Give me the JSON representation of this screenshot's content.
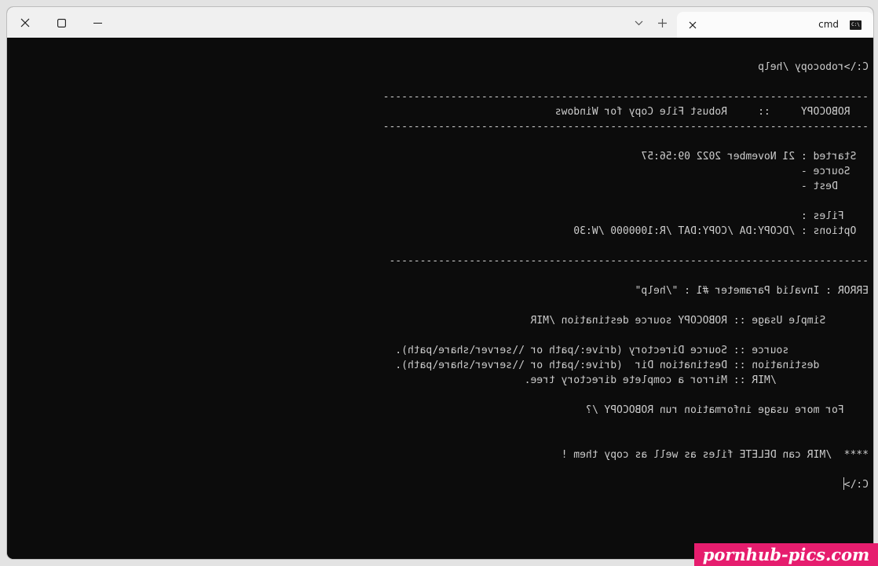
{
  "window": {
    "tab_title": "cmd",
    "tab_icon_glyph": "C:\\",
    "controls": [
      "close-icon",
      "maximize-icon",
      "minimize-icon",
      "chevron-down-icon",
      "plus-icon"
    ]
  },
  "console": {
    "lines": [
      "C:\\>robocopy /help",
      "",
      "-------------------------------------------------------------------------------",
      "   ROBOCOPY     ::     Robust File Copy for Windows",
      "-------------------------------------------------------------------------------",
      "",
      "  Started : 21 November 2022 09:56:57",
      "   Source -",
      "     Dest -",
      "",
      "    Files :",
      "  Options : /DCOPY:DA /COPY:DAT /R:1000000 /W:30",
      "",
      "------------------------------------------------------------------------------",
      "",
      "ERROR : Invalid Parameter #1 : \"/help\"",
      "",
      "       Simple Usage :: ROBOCOPY source destination /MIR",
      "",
      "             source :: Source Directory (drive:\\path or \\\\server\\share\\path).",
      "        destination :: Destination Dir  (drive:\\path or \\\\server\\share\\path).",
      "               /MIR :: Mirror a complete directory tree.",
      "",
      "    For more usage information run ROBOCOPY /?",
      "",
      "",
      "****  /MIR can DELETE files as well as copy them !",
      "",
      "C:\\>"
    ]
  },
  "watermark": "pornhub-pics.com",
  "colors": {
    "console_bg": "#0c0c0c",
    "console_fg": "#cccccc",
    "titlebar_bg": "#f0f0f0",
    "tab_bg": "#fbfbfb",
    "watermark_bg": "#e61d6e"
  }
}
